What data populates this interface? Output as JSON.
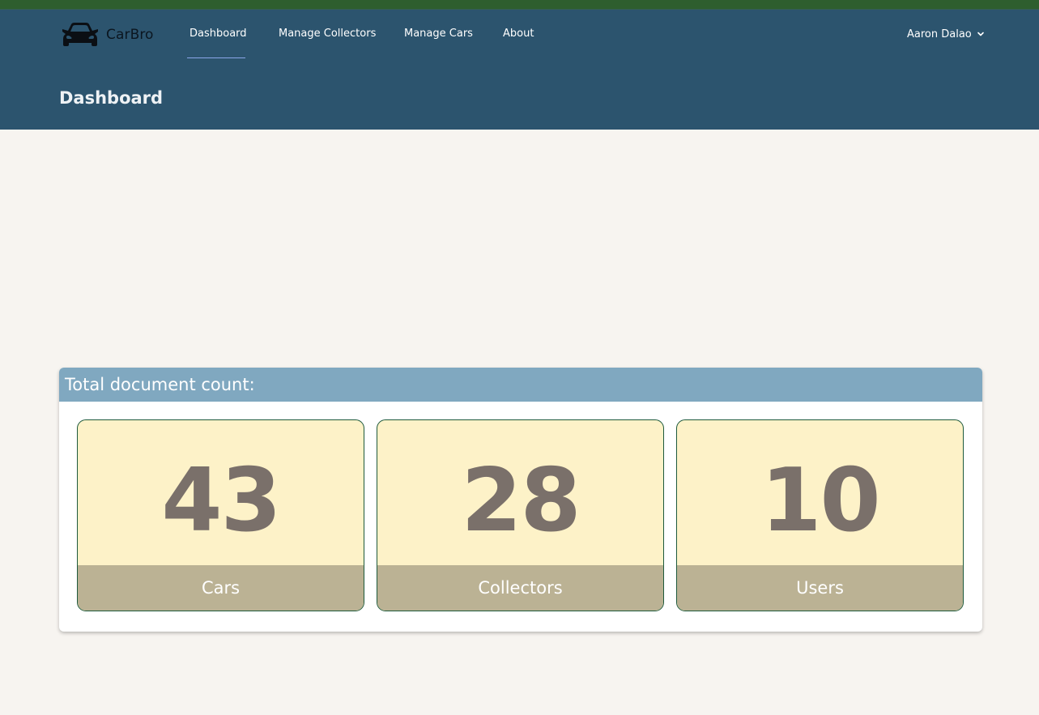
{
  "brand": {
    "name": "CarBro",
    "logo_icon": "car-icon"
  },
  "nav": {
    "items": [
      {
        "label": "Dashboard",
        "active": true
      },
      {
        "label": "Manage Collectors",
        "active": false
      },
      {
        "label": "Manage Cars",
        "active": false
      },
      {
        "label": "About",
        "active": false
      }
    ]
  },
  "user": {
    "name": "Aaron Dalao",
    "menu_icon": "chevron-down-icon"
  },
  "page": {
    "title": "Dashboard"
  },
  "panel": {
    "heading": "Total document count:",
    "cards": [
      {
        "value": "43",
        "label": "Cars"
      },
      {
        "value": "28",
        "label": "Collectors"
      },
      {
        "value": "10",
        "label": "Users"
      }
    ]
  },
  "colors": {
    "top_strip": "#2e5e2e",
    "header": "#2c546e",
    "page_bg": "#f7f4f0",
    "panel_head": "#80a8c0",
    "card_bg": "#fdf2c8",
    "card_footer": "#bbb294",
    "card_value": "#7a706a",
    "card_border": "#1e5a3c",
    "nav_underline": "#8aa6e8"
  }
}
